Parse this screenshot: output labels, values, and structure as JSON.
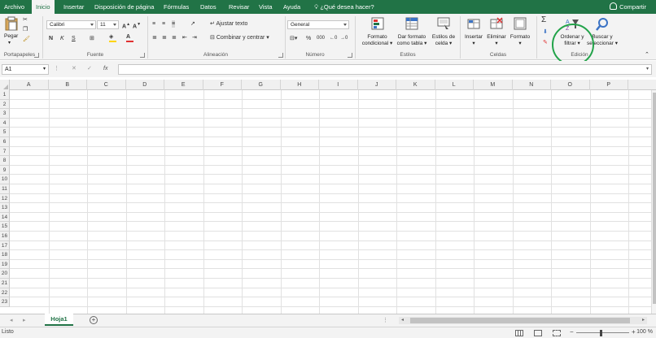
{
  "tabs": [
    "Archivo",
    "Inicio",
    "Insertar",
    "Disposición de página",
    "Fórmulas",
    "Datos",
    "Revisar",
    "Vista",
    "Ayuda"
  ],
  "tell_me": "¿Qué desea hacer?",
  "share": "Compartir",
  "ribbon": {
    "clipboard": {
      "paste": "Pegar",
      "label": "Portapapeles"
    },
    "font": {
      "name": "Calibri",
      "size": "11",
      "bold": "N",
      "italic": "K",
      "underline": "S",
      "label": "Fuente"
    },
    "alignment": {
      "wrap": "Ajustar texto",
      "merge": "Combinar y centrar",
      "label": "Alineación"
    },
    "number": {
      "format": "General",
      "percent": "%",
      "thousands": "000",
      "label": "Número"
    },
    "styles": {
      "cond_format": [
        "Formato",
        "condicional"
      ],
      "table_format": [
        "Dar formato",
        "como tabla"
      ],
      "cell_styles": [
        "Estilos de",
        "celda"
      ],
      "label": "Estilos"
    },
    "cells": {
      "insert": "Insertar",
      "delete": "Eliminar",
      "format": "Formato",
      "label": "Celdas"
    },
    "editing": {
      "sort": [
        "Ordenar y",
        "filtrar"
      ],
      "find": [
        "Buscar y",
        "seleccionar"
      ],
      "label": "Edición"
    },
    "colors": {
      "font_color": "#e03131",
      "fill_color": "#ffd400"
    }
  },
  "formula_bar": {
    "name_box": "A1",
    "fx": "fx",
    "cancel": "✕",
    "enter": "✓",
    "formula": ""
  },
  "columns": [
    "A",
    "B",
    "C",
    "D",
    "E",
    "F",
    "G",
    "H",
    "I",
    "J",
    "K",
    "L",
    "M",
    "N",
    "O",
    "P"
  ],
  "rows": [
    "1",
    "2",
    "3",
    "4",
    "5",
    "6",
    "7",
    "8",
    "9",
    "10",
    "11",
    "12",
    "13",
    "14",
    "15",
    "16",
    "17",
    "18",
    "19",
    "20",
    "21",
    "22",
    "23"
  ],
  "sheet": {
    "name": "Hoja1",
    "add": "+"
  },
  "status": {
    "text": "Listo",
    "zoom": "100 %"
  },
  "brand_color": "#217346"
}
